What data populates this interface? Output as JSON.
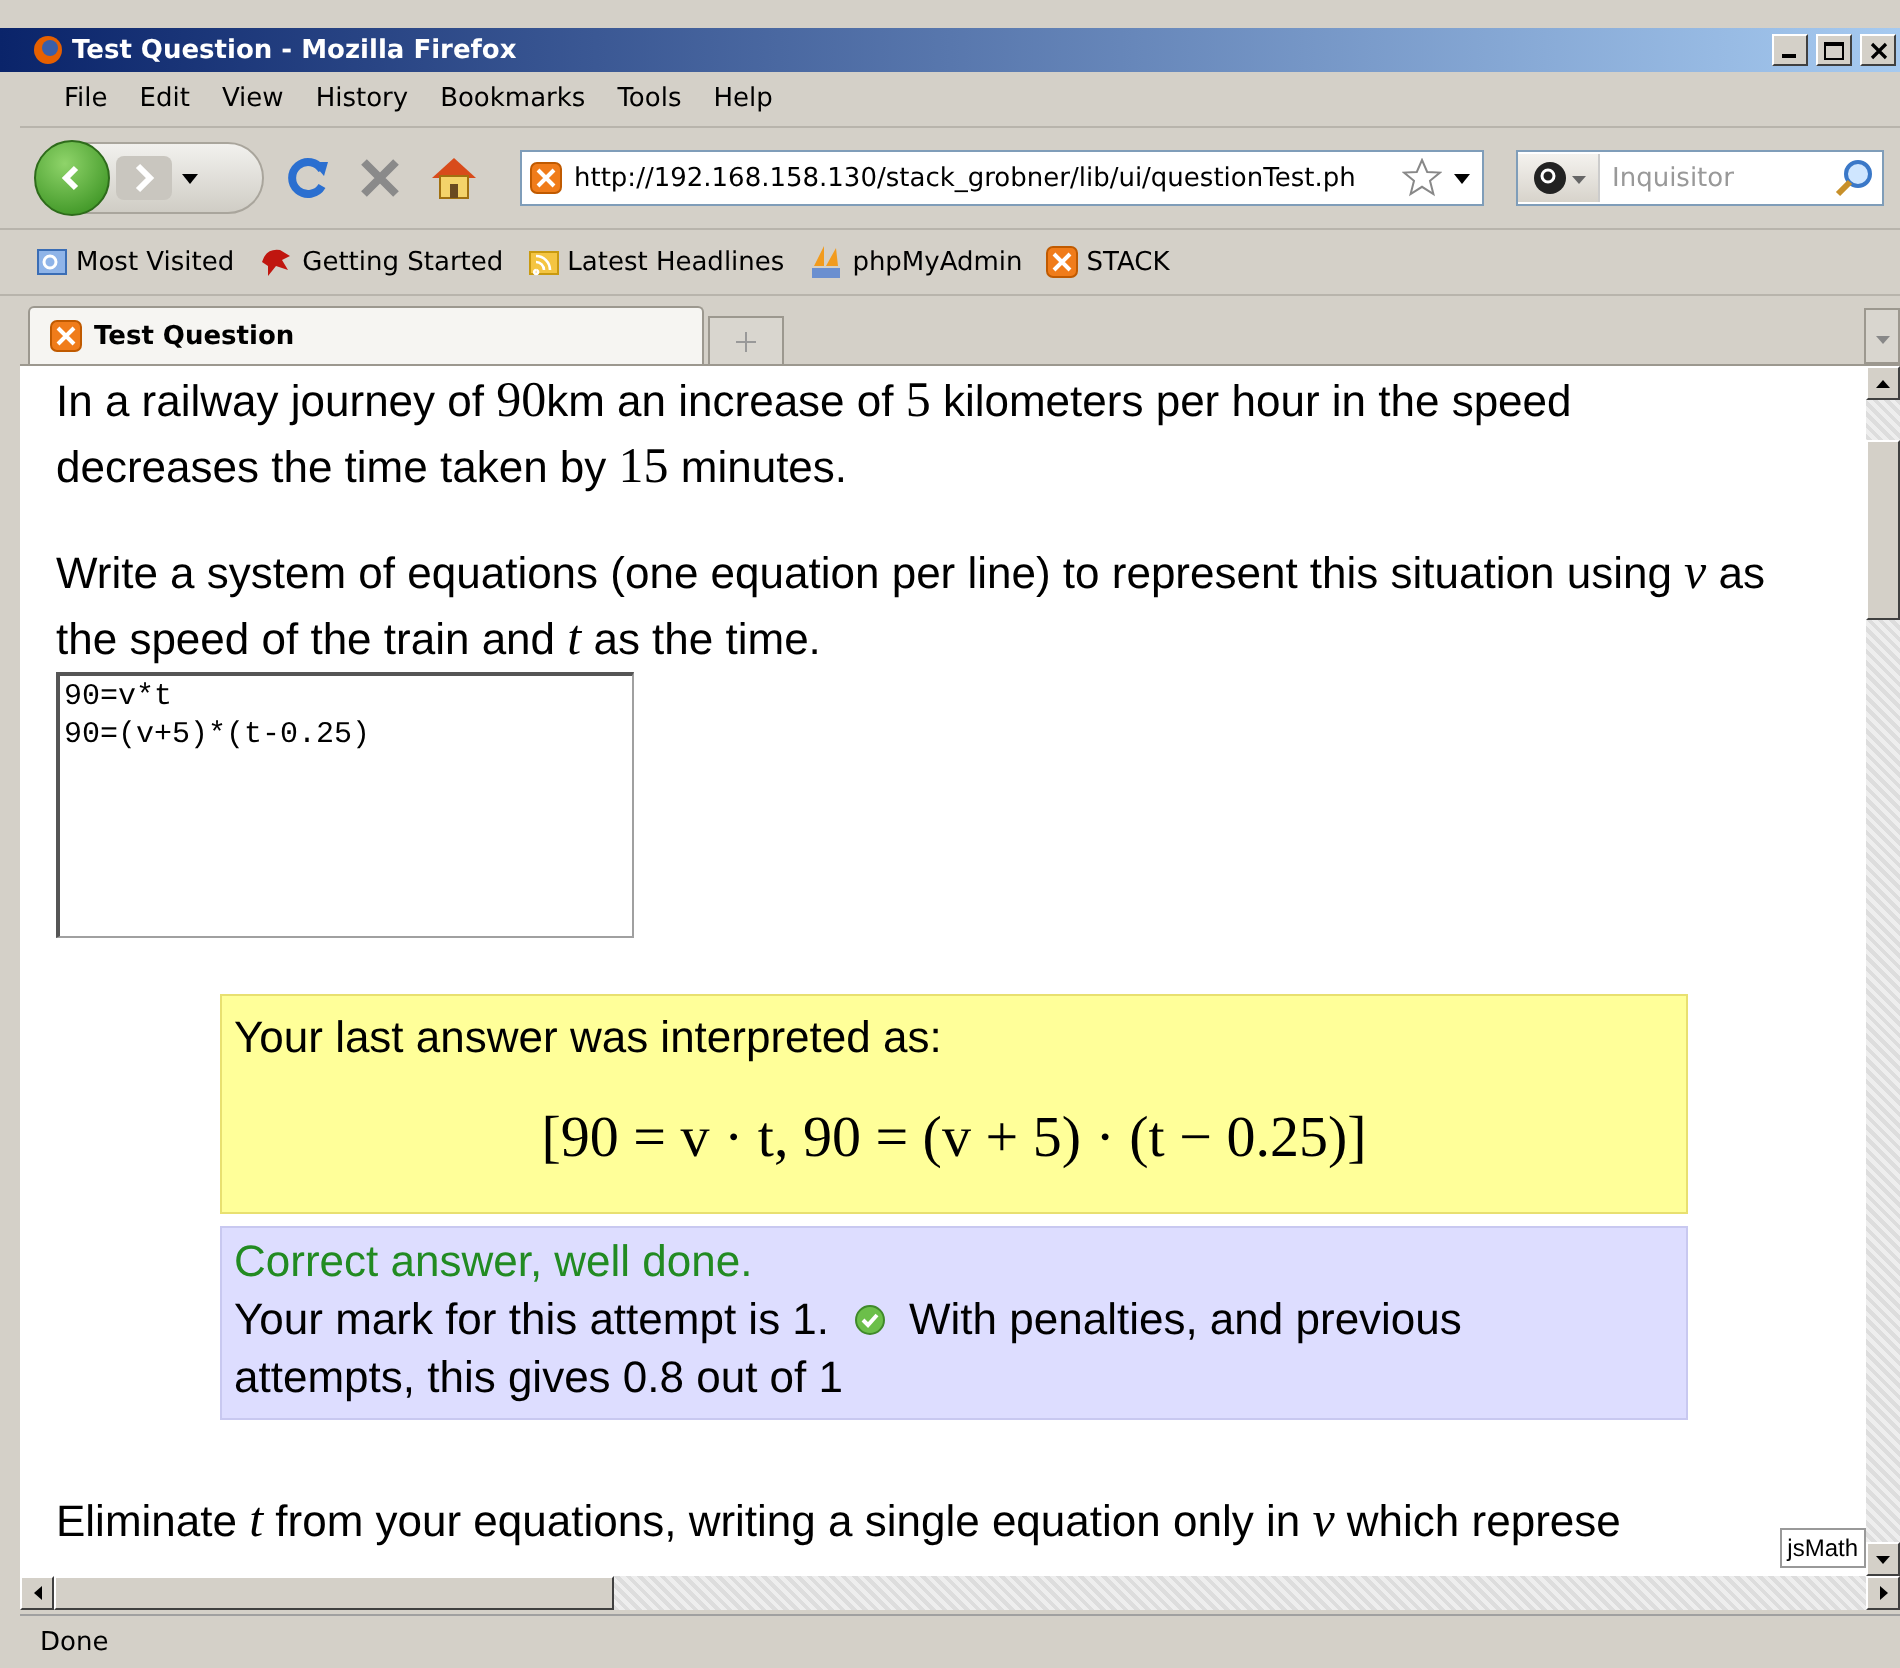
{
  "window": {
    "title": "Test Question - Mozilla Firefox"
  },
  "menu": [
    {
      "label": "File"
    },
    {
      "label": "Edit"
    },
    {
      "label": "View"
    },
    {
      "label": "History"
    },
    {
      "label": "Bookmarks"
    },
    {
      "label": "Tools"
    },
    {
      "label": "Help"
    }
  ],
  "address_bar": {
    "value": "http://192.168.158.130/stack_grobner/lib/ui/questionTest.ph"
  },
  "search": {
    "placeholder": "Inquisitor"
  },
  "bookmarks": [
    {
      "label": "Most Visited",
      "kind": "folder"
    },
    {
      "label": "Getting Started",
      "kind": "dragon"
    },
    {
      "label": "Latest Headlines",
      "kind": "feed"
    },
    {
      "label": "phpMyAdmin",
      "kind": "pma"
    },
    {
      "label": "STACK",
      "kind": "stack"
    }
  ],
  "tabs": [
    {
      "label": "Test Question",
      "selected": true
    }
  ],
  "content": {
    "paragraphs": [
      [
        {
          "kind": "text",
          "text": "In a railway journey of "
        },
        {
          "kind": "math",
          "text": "90"
        },
        {
          "kind": "text",
          "text": "km an increase of "
        },
        {
          "kind": "math",
          "text": "5"
        },
        {
          "kind": "text",
          "text": " kilometers per hour in the speed decreases the time taken by "
        },
        {
          "kind": "math",
          "text": "15"
        },
        {
          "kind": "text",
          "text": " minutes."
        }
      ],
      [
        {
          "kind": "text",
          "text": "Write a system of equations (one equation per line) to represent this situation using "
        },
        {
          "kind": "math",
          "text": "v"
        },
        {
          "kind": "text",
          "text": " as the speed of the train and "
        },
        {
          "kind": "math",
          "text": "t"
        },
        {
          "kind": "text",
          "text": " as the time."
        }
      ]
    ],
    "answer_box": {
      "value": "90=v*t\n90=(v+5)*(t-0.25)"
    },
    "interpretation": {
      "label": "Your last answer was interpreted as:",
      "formula": "[90 = v · t, 90 = (v + 5) · (t − 0.25)]"
    },
    "feedback": {
      "verdict": "Correct answer, well done.",
      "mark": "Your mark for this attempt is 1.",
      "correct": true,
      "penalty_lines": [
        "With penalties, and previous",
        "attempts, this gives 0.8 out of 1"
      ]
    },
    "next_paragraph": [
      {
        "kind": "text",
        "text": "Eliminate "
      },
      {
        "kind": "math",
        "text": "t"
      },
      {
        "kind": "text",
        "text": " from your equations, writing a single equation only in "
      },
      {
        "kind": "math",
        "text": "v"
      },
      {
        "kind": "text",
        "text": " which represe"
      }
    ],
    "badge": "jsMath"
  },
  "status_bar": "Done"
}
